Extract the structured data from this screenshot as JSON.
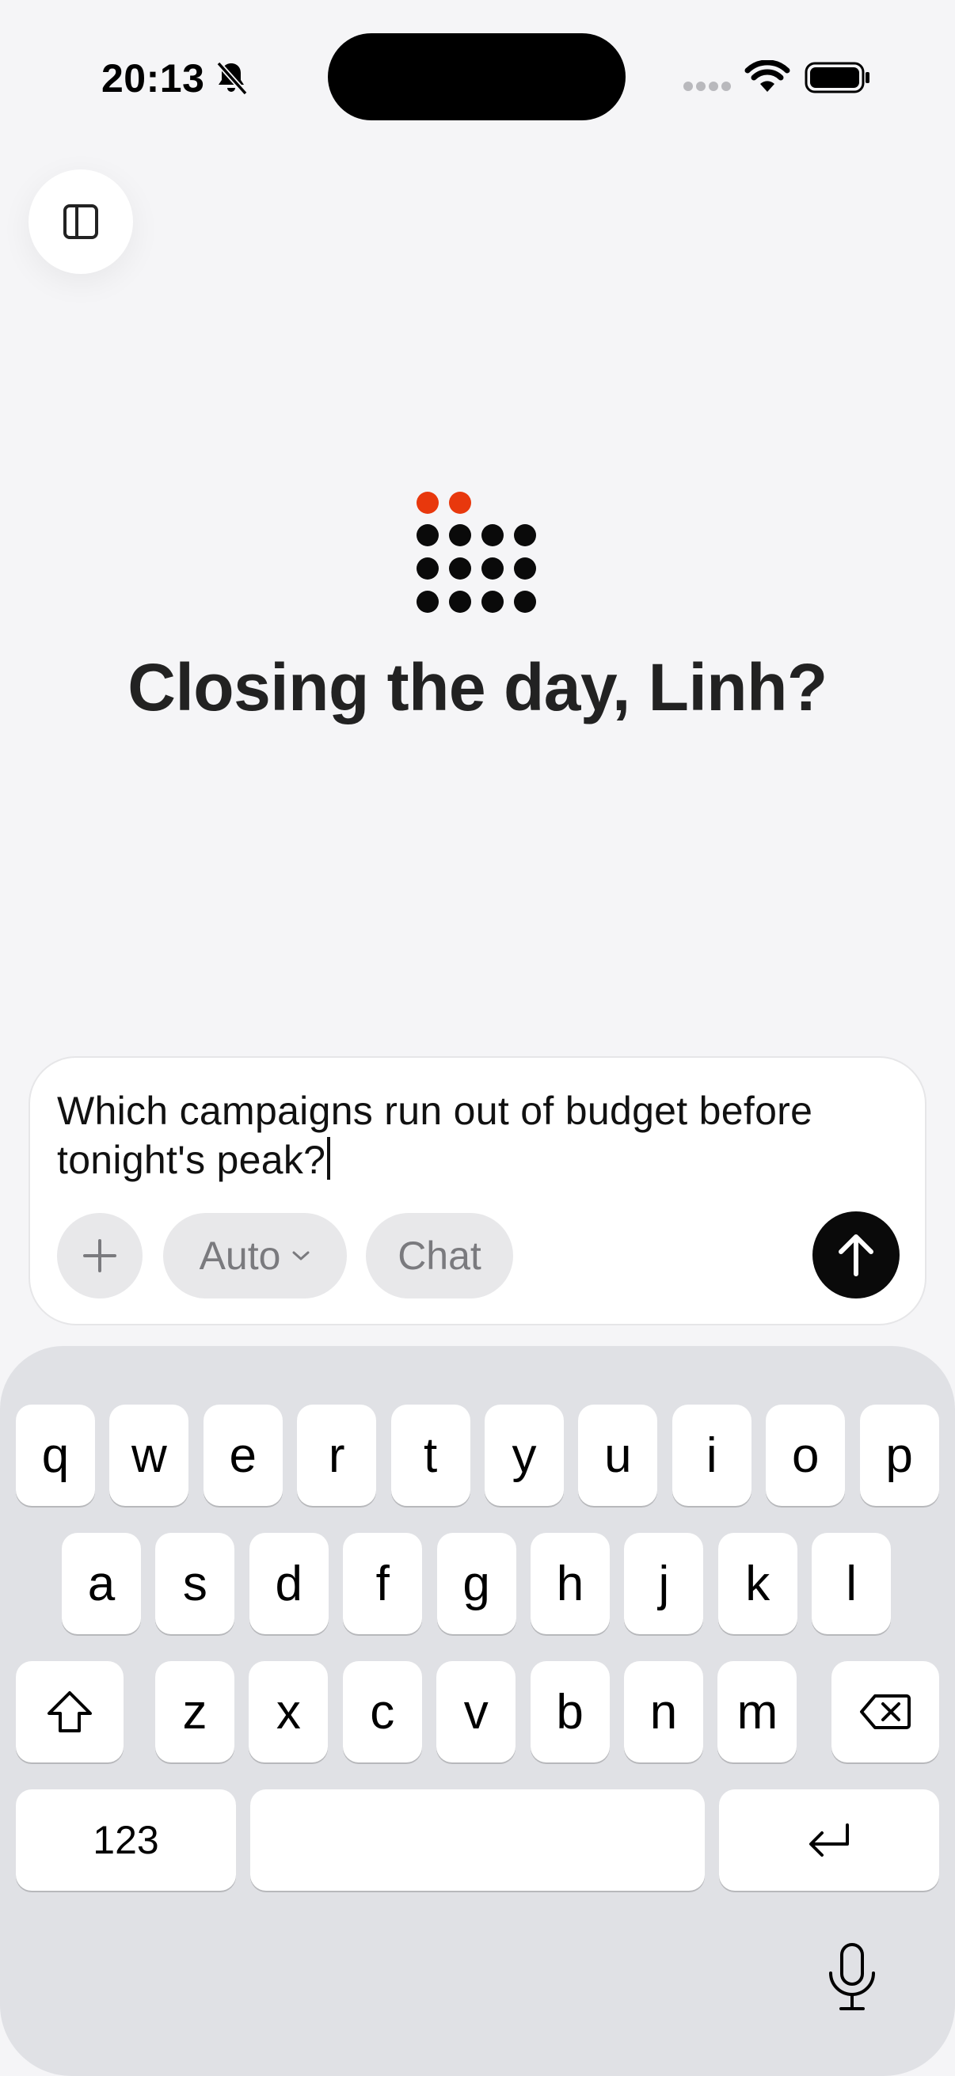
{
  "status_bar": {
    "time": "20:13",
    "icons": [
      "bell-slash-icon",
      "signal-icon",
      "wifi-icon",
      "battery-icon"
    ]
  },
  "sidebar_toggle": {
    "icon": "sidebar-panel-icon"
  },
  "logo": {
    "accent_color": "#e8380d",
    "dot_color": "#0a0a0a"
  },
  "greeting": "Closing the day, Linh?",
  "composer": {
    "text": "Which campaigns run out of budget before tonight's peak?",
    "line1": "Which campaigns run out of budget before",
    "line2": "tonight's peak?",
    "add_icon": "plus-icon",
    "model_label": "Auto",
    "mode_label": "Chat",
    "send_icon": "arrow-up-icon"
  },
  "keyboard": {
    "row1": [
      "q",
      "w",
      "e",
      "r",
      "t",
      "y",
      "u",
      "i",
      "o",
      "p"
    ],
    "row2": [
      "a",
      "s",
      "d",
      "f",
      "g",
      "h",
      "j",
      "k",
      "l"
    ],
    "row3": [
      "z",
      "x",
      "c",
      "v",
      "b",
      "n",
      "m"
    ],
    "numbers_label": "123",
    "space_label": "",
    "shift_icon": "shift-icon",
    "delete_icon": "delete-icon",
    "return_icon": "return-icon",
    "mic_icon": "microphone-icon"
  }
}
